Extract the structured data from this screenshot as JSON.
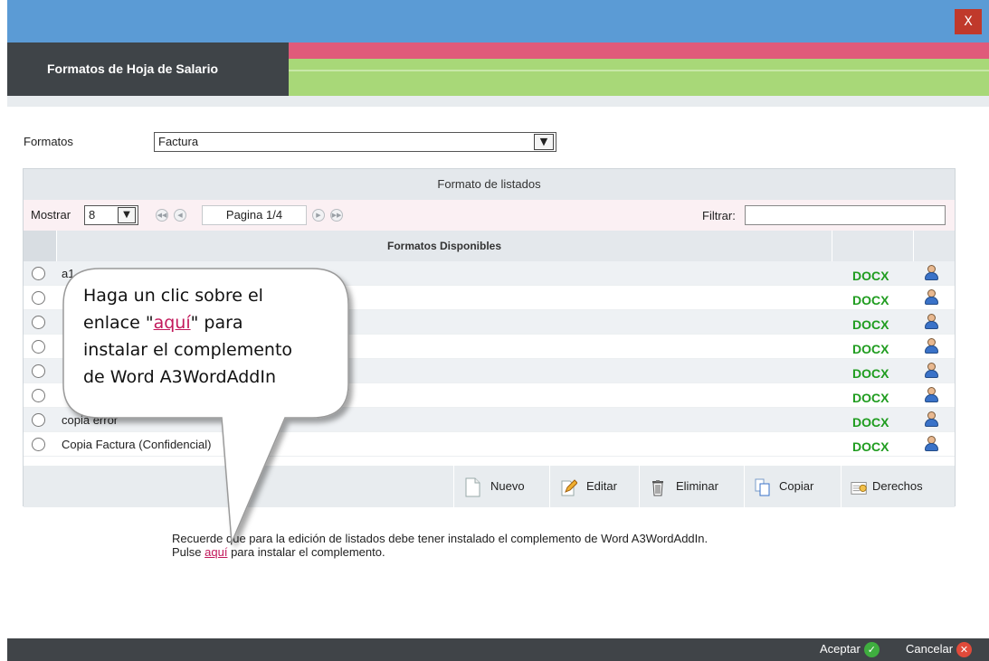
{
  "window": {
    "close_label": "X"
  },
  "header": {
    "title": "Formatos de Hoja de Salario"
  },
  "formatos": {
    "label": "Formatos",
    "selected": "Factura"
  },
  "panel": {
    "title": "Formato de listados",
    "mostrar_label": "Mostrar",
    "page_size": "8",
    "page_info": "Pagina 1/4",
    "filtrar_label": "Filtrar:",
    "filtrar_value": "",
    "column_header": "Formatos Disponibles",
    "rows": [
      {
        "name": "a1",
        "format": "DOCX"
      },
      {
        "name": "",
        "format": "DOCX"
      },
      {
        "name": "",
        "format": "DOCX"
      },
      {
        "name": "",
        "format": "DOCX"
      },
      {
        "name": "",
        "format": "DOCX"
      },
      {
        "name": "",
        "format": "DOCX"
      },
      {
        "name": "copia error",
        "format": "DOCX"
      },
      {
        "name": "Copia Factura (Confidencial)",
        "format": "DOCX"
      }
    ],
    "actions": {
      "nuevo": "Nuevo",
      "editar": "Editar",
      "eliminar": "Eliminar",
      "copiar": "Copiar",
      "derechos": "Derechos"
    }
  },
  "note": {
    "line1": "Recuerde que para la edición de listados debe tener instalado el complemento de Word A3WordAddIn.",
    "line2_pre": "Pulse ",
    "line2_link": "aquí",
    "line2_post": " para instalar el complemento."
  },
  "footer": {
    "accept": "Aceptar",
    "cancel": "Cancelar"
  },
  "callout": {
    "line1": "Haga un clic sobre el",
    "line2_pre": "enlace \"",
    "line2_link": "aquí",
    "line2_post": "\" para",
    "line3": "instalar el complemento",
    "line4": "de Word A3WordAddIn"
  },
  "colors": {
    "accent": "#5b9bd5",
    "pink": "#e05a7a",
    "green": "#a8d878",
    "docx": "#1f9c1f",
    "link": "#c2185b"
  }
}
